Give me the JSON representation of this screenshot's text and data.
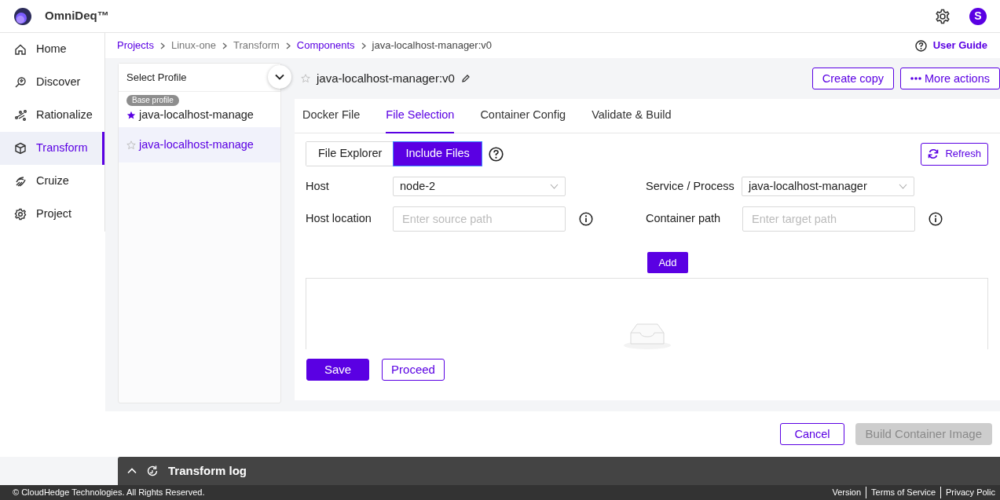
{
  "app": {
    "name": "OmniDeq™",
    "avatar": "S"
  },
  "sidebar": {
    "items": [
      {
        "label": "Home",
        "selected": false
      },
      {
        "label": "Discover",
        "selected": false
      },
      {
        "label": "Rationalize",
        "selected": false
      },
      {
        "label": "Transform",
        "selected": true
      },
      {
        "label": "Cruize",
        "selected": false
      },
      {
        "label": "Project",
        "selected": false
      }
    ]
  },
  "breadcrumb": [
    {
      "label": "Projects",
      "link": true
    },
    {
      "label": "Linux-one",
      "link": false
    },
    {
      "label": "Transform",
      "link": false
    },
    {
      "label": "Components",
      "link": true
    },
    {
      "label": "java-localhost-manager:v0",
      "link": false
    }
  ],
  "user_guide": "User Guide",
  "profiles": {
    "title": "Select Profile",
    "items": [
      {
        "badge": "Base profile",
        "name": "java-localhost-manage",
        "starred": true,
        "selected": false
      },
      {
        "name": "java-localhost-manage",
        "starred": false,
        "selected": true
      }
    ]
  },
  "component": {
    "title": "java-localhost-manager:v0",
    "starred": false
  },
  "actions": [
    {
      "label": "Create copy",
      "kind": "plain"
    },
    {
      "label": "More actions",
      "kind": "more"
    }
  ],
  "tabs": [
    {
      "label": "Docker File",
      "selected": false
    },
    {
      "label": "File Selection",
      "selected": true
    },
    {
      "label": "Container Config",
      "selected": false
    },
    {
      "label": "Validate & Build",
      "selected": false
    }
  ],
  "mode_toggle": [
    {
      "label": "File Explorer",
      "selected": false
    },
    {
      "label": "Include Files",
      "selected": true
    }
  ],
  "refresh": "Refresh",
  "form": {
    "host": {
      "label": "Host",
      "value": "node-2"
    },
    "service": {
      "label": "Service / Process",
      "value": "java-localhost-manager"
    },
    "host_location": {
      "label": "Host location",
      "placeholder": "Enter source path"
    },
    "container_path": {
      "label": "Container path",
      "placeholder": "Enter target path"
    }
  },
  "add": "Add",
  "buttons": [
    {
      "label": "Save",
      "kind": "primary"
    },
    {
      "label": "Proceed",
      "kind": "outline"
    }
  ],
  "footer_actions": [
    {
      "label": "Cancel",
      "disabled": false
    },
    {
      "label": "Build Container Image",
      "disabled": true
    }
  ],
  "log_bar": {
    "title": "Transform log",
    "expanded": false
  },
  "footer": {
    "copyright": "© CloudHedge Technologies. All Rights Reserved.",
    "links": [
      "Version",
      "Terms of Service",
      "Privacy Polic"
    ]
  }
}
